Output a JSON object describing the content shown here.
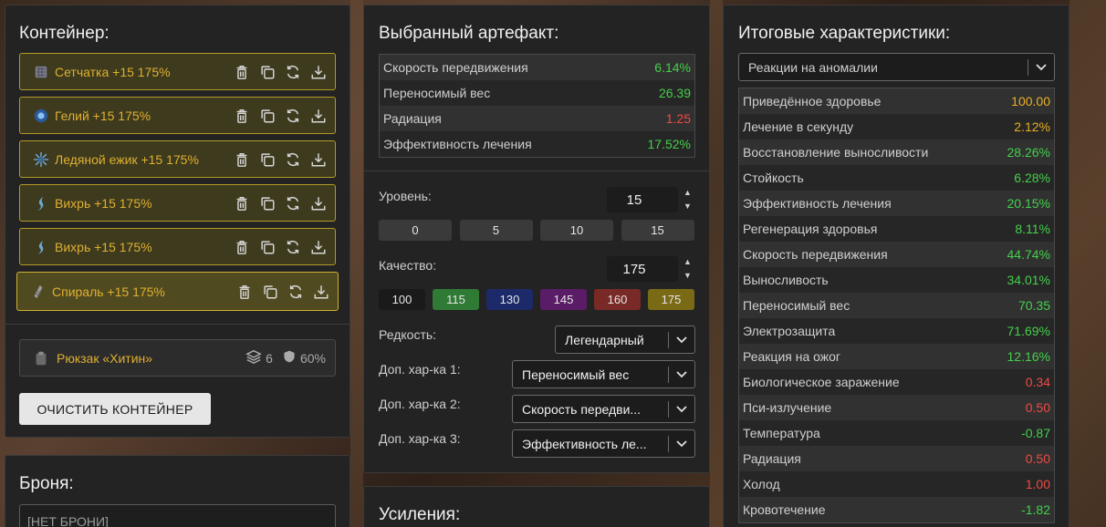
{
  "container": {
    "title": "Контейнер:",
    "artifacts": [
      {
        "name": "Сетчатка +15 175%",
        "icon": "retina-artifact-icon"
      },
      {
        "name": "Гелий +15 175%",
        "icon": "helium-artifact-icon"
      },
      {
        "name": "Ледяной ежик +15 175%",
        "icon": "ice-hedgehog-artifact-icon"
      },
      {
        "name": "Вихрь +15 175%",
        "icon": "whirl-artifact-icon"
      },
      {
        "name": "Вихрь +15 175%",
        "icon": "whirl-artifact-icon"
      },
      {
        "name": "Спираль +15 175%",
        "icon": "spiral-artifact-icon"
      }
    ],
    "backpack": {
      "name": "Рюкзак «Хитин»",
      "slots": "6",
      "protection": "60%"
    },
    "clear_button": "ОЧИСТИТЬ КОНТЕЙНЕР"
  },
  "armor": {
    "title": "Броня:",
    "value": "[НЕТ БРОНИ]"
  },
  "selected": {
    "title": "Выбранный артефакт:",
    "stats": [
      {
        "label": "Скорость передвижения",
        "value": "6.14%",
        "color": "green"
      },
      {
        "label": "Переносимый вес",
        "value": "26.39",
        "color": "green"
      },
      {
        "label": "Радиация",
        "value": "1.25",
        "color": "red"
      },
      {
        "label": "Эффективность лечения",
        "value": "17.52%",
        "color": "green"
      }
    ],
    "level_label": "Уровень:",
    "level_value": "15",
    "level_presets": [
      "0",
      "5",
      "10",
      "15"
    ],
    "quality_label": "Качество:",
    "quality_value": "175",
    "quality_presets": [
      {
        "label": "100",
        "color": "#1a1a1a"
      },
      {
        "label": "115",
        "color": "#2f7a34"
      },
      {
        "label": "130",
        "color": "#1c2a6a"
      },
      {
        "label": "145",
        "color": "#5a1c66"
      },
      {
        "label": "160",
        "color": "#7a2a26"
      },
      {
        "label": "175",
        "color": "#7a6a16"
      }
    ],
    "rarity_label": "Редкость:",
    "rarity_value": "Легендарный",
    "extra1_label": "Доп. хар-ка 1:",
    "extra1_value": "Переносимый вес",
    "extra2_label": "Доп. хар-ка 2:",
    "extra2_value": "Скорость передви...",
    "extra3_label": "Доп. хар-ка 3:",
    "extra3_value": "Эффективность ле..."
  },
  "boosts": {
    "title": "Усиления:"
  },
  "totals": {
    "title": "Итоговые характеристики:",
    "filter_value": "Реакции на аномалии",
    "stats": [
      {
        "label": "Приведённое здоровье",
        "value": "100.00",
        "color": "yellow"
      },
      {
        "label": "Лечение в секунду",
        "value": "2.12%",
        "color": "yellow"
      },
      {
        "label": "Восстановление выносливости",
        "value": "28.26%",
        "color": "green"
      },
      {
        "label": "Стойкость",
        "value": "6.28%",
        "color": "green"
      },
      {
        "label": "Эффективность лечения",
        "value": "20.15%",
        "color": "green"
      },
      {
        "label": "Регенерация здоровья",
        "value": "8.11%",
        "color": "green"
      },
      {
        "label": "Скорость передвижения",
        "value": "44.74%",
        "color": "green"
      },
      {
        "label": "Выносливость",
        "value": "34.01%",
        "color": "green"
      },
      {
        "label": "Переносимый вес",
        "value": "70.35",
        "color": "green"
      },
      {
        "label": "Электрозащита",
        "value": "71.69%",
        "color": "green"
      },
      {
        "label": "Реакция на ожог",
        "value": "12.16%",
        "color": "green"
      },
      {
        "label": "Биологическое заражение",
        "value": "0.34",
        "color": "red"
      },
      {
        "label": "Пси-излучение",
        "value": "0.50",
        "color": "red"
      },
      {
        "label": "Температура",
        "value": "-0.87",
        "color": "green"
      },
      {
        "label": "Радиация",
        "value": "0.50",
        "color": "red"
      },
      {
        "label": "Холод",
        "value": "1.00",
        "color": "red"
      },
      {
        "label": "Кровотечение",
        "value": "-1.82",
        "color": "green"
      }
    ]
  }
}
